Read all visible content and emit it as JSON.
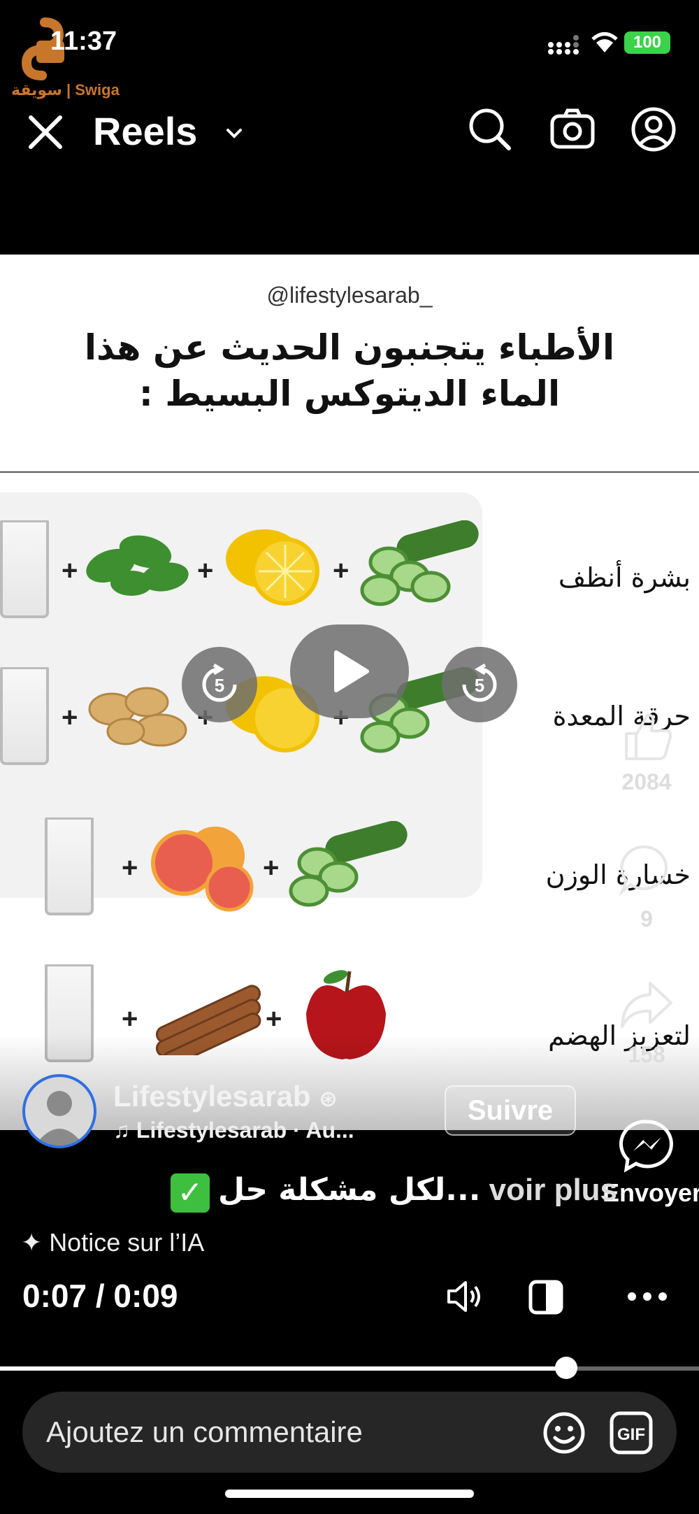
{
  "status": {
    "time": "11:37",
    "battery": "100"
  },
  "brand": {
    "text": "سويقة | Swiga"
  },
  "header": {
    "title": "Reels",
    "icons": [
      "close-icon",
      "chevron-down-icon",
      "search-icon",
      "camera-icon",
      "profile-icon"
    ]
  },
  "post_image": {
    "handle": "@lifestylesarab_",
    "title": "الأطباء يتجنبون الحديث عن هذا الماء الديتوكس البسيط :",
    "rows": [
      {
        "label": "بشرة أنظف"
      },
      {
        "label": "حرقة المعدة"
      },
      {
        "label": "خسارة الوزن"
      },
      {
        "label": "لتعزيز الهضم"
      }
    ]
  },
  "player": {
    "skip_back": "5",
    "skip_forward": "5",
    "current_time": "0:07",
    "total_time": "0:09",
    "progress": 0.81
  },
  "rail": {
    "likes": "2084",
    "comments": "9",
    "shares": "158",
    "send_label": "Envoyer"
  },
  "author": {
    "username": "Lifestylesarab",
    "audio": "Lifestylesarab · Au...",
    "follow_label": "Suivre"
  },
  "caption": {
    "text": "لكل مشكلة حل...",
    "more": "voir plus"
  },
  "ai_notice": "Notice sur l’IA",
  "comment": {
    "placeholder": "Ajoutez un commentaire"
  },
  "colors": {
    "accent_blue": "#2f6fe3",
    "battery_green": "#3ad34a",
    "check_green": "#3fbf3f"
  }
}
